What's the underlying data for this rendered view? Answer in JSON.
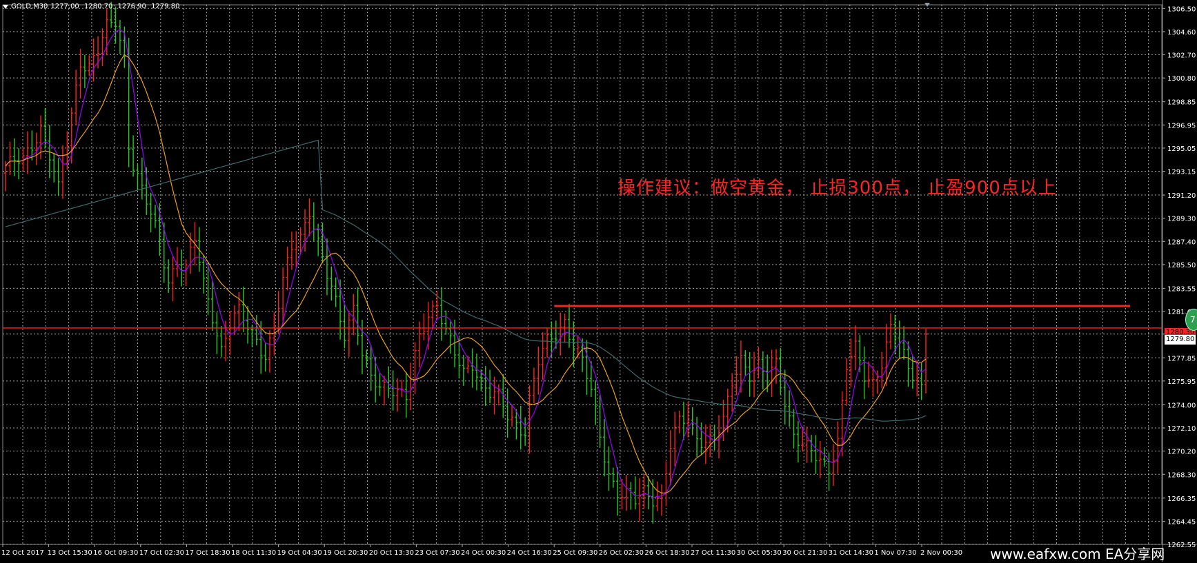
{
  "header": {
    "symbol": "GOLD,M30",
    "open": "1277.00",
    "high": "1280.70",
    "low": "1276.90",
    "close": "1279.80"
  },
  "annotation": "操作建议：做空黄金，  止损300点，  止盈900点以上",
  "watermark": "www.eafxw.com  EA分享网",
  "price_labels": {
    "current_price": "1279.80",
    "line_price": "1280.30",
    "badge": "7"
  },
  "colors": {
    "background": "#000000",
    "grid": "#cfcfcf",
    "bull_candle": "#ff2020",
    "bear_candle": "#22cc22",
    "ma_fast": "#9a00ff",
    "ma_mid": "#e8a020",
    "ma_slow": "#3d6b6b",
    "level_lines": "#ff2020"
  },
  "chart_data": {
    "type": "candlestick",
    "symbol": "GOLD",
    "timeframe": "M30",
    "ylim": [
      1262.55,
      1306.8
    ],
    "y_ticks": [
      "1306.50",
      "1304.60",
      "1302.70",
      "1300.80",
      "1298.85",
      "1296.95",
      "1295.05",
      "1293.15",
      "1291.20",
      "1289.30",
      "1287.40",
      "1285.50",
      "1283.55",
      "1281.65",
      "1279.80",
      "1277.85",
      "1275.95",
      "1274.00",
      "1272.10",
      "1270.20",
      "1268.30",
      "1266.35",
      "1264.45",
      "1262.55"
    ],
    "x_ticks": [
      "12 Oct 2017",
      "13 Oct 15:30",
      "16 Oct 09:30",
      "17 Oct 02:30",
      "17 Oct 18:30",
      "18 Oct 11:30",
      "19 Oct 04:30",
      "19 Oct 20:30",
      "20 Oct 13:30",
      "23 Oct 07:30",
      "24 Oct 00:30",
      "24 Oct 16:30",
      "25 Oct 09:30",
      "26 Oct 02:30",
      "26 Oct 18:30",
      "27 Oct 11:30",
      "30 Oct 05:30",
      "30 Oct 21:30",
      "31 Oct 14:30",
      "1 Nov 07:30",
      "2 Nov 00:30"
    ],
    "close_path": [
      [
        0,
        1293.6
      ],
      [
        4,
        1294.0
      ],
      [
        8,
        1296.8
      ],
      [
        10,
        1294.5
      ],
      [
        12,
        1291.5
      ],
      [
        14,
        1295.5
      ],
      [
        17,
        1302.3
      ],
      [
        19,
        1301.8
      ],
      [
        21,
        1303.0
      ],
      [
        23,
        1304.8
      ],
      [
        25,
        1305.5
      ],
      [
        27,
        1302.5
      ],
      [
        28,
        1295.5
      ],
      [
        29,
        1293.8
      ],
      [
        31,
        1291.5
      ],
      [
        33,
        1289.5
      ],
      [
        35,
        1287.5
      ],
      [
        37,
        1284.3
      ],
      [
        39,
        1285.8
      ],
      [
        41,
        1285.0
      ],
      [
        43,
        1287.5
      ],
      [
        45,
        1284.0
      ],
      [
        47,
        1281.5
      ],
      [
        49,
        1278.5
      ],
      [
        51,
        1280.5
      ],
      [
        53,
        1281.5
      ],
      [
        55,
        1280.5
      ],
      [
        57,
        1279.5
      ],
      [
        59,
        1278.0
      ],
      [
        61,
        1280.0
      ],
      [
        63,
        1284.0
      ],
      [
        65,
        1287.0
      ],
      [
        67,
        1288.0
      ],
      [
        69,
        1290.0
      ],
      [
        70,
        1288.5
      ],
      [
        71,
        1287.0
      ],
      [
        73,
        1284.5
      ],
      [
        75,
        1282.5
      ],
      [
        77,
        1280.0
      ],
      [
        79,
        1282.0
      ],
      [
        81,
        1278.0
      ],
      [
        83,
        1276.0
      ],
      [
        85,
        1275.5
      ],
      [
        87,
        1275.8
      ],
      [
        89,
        1275.2
      ],
      [
        91,
        1274.5
      ],
      [
        92,
        1276.0
      ],
      [
        94,
        1279.5
      ],
      [
        96,
        1281.5
      ],
      [
        98,
        1282.5
      ],
      [
        100,
        1280.0
      ],
      [
        102,
        1278.0
      ],
      [
        104,
        1276.5
      ],
      [
        106,
        1277.5
      ],
      [
        108,
        1276.0
      ],
      [
        110,
        1275.0
      ],
      [
        112,
        1274.5
      ],
      [
        114,
        1273.0
      ],
      [
        116,
        1272.5
      ],
      [
        118,
        1272.0
      ],
      [
        119,
        1274.5
      ],
      [
        121,
        1277.5
      ],
      [
        123,
        1279.0
      ],
      [
        125,
        1279.8
      ],
      [
        127,
        1281.0
      ],
      [
        129,
        1279.0
      ],
      [
        131,
        1277.5
      ],
      [
        133,
        1275.0
      ],
      [
        135,
        1271.5
      ],
      [
        137,
        1268.5
      ],
      [
        139,
        1266.8
      ],
      [
        141,
        1266.5
      ],
      [
        143,
        1266.0
      ],
      [
        145,
        1267.0
      ],
      [
        147,
        1266.5
      ],
      [
        149,
        1266.5
      ],
      [
        151,
        1270.5
      ],
      [
        153,
        1272.5
      ],
      [
        155,
        1273.0
      ],
      [
        157,
        1271.5
      ],
      [
        159,
        1271.0
      ],
      [
        161,
        1271.0
      ],
      [
        163,
        1272.5
      ],
      [
        165,
        1276.0
      ],
      [
        167,
        1278.0
      ],
      [
        169,
        1276.5
      ],
      [
        171,
        1277.0
      ],
      [
        173,
        1276.0
      ],
      [
        175,
        1277.5
      ],
      [
        177,
        1274.5
      ],
      [
        179,
        1271.5
      ],
      [
        181,
        1270.5
      ],
      [
        183,
        1270.0
      ],
      [
        185,
        1269.5
      ],
      [
        187,
        1269.0
      ],
      [
        189,
        1271.0
      ],
      [
        191,
        1277.0
      ],
      [
        193,
        1278.5
      ],
      [
        195,
        1276.5
      ],
      [
        197,
        1276.0
      ],
      [
        199,
        1277.5
      ],
      [
        201,
        1280.0
      ],
      [
        203,
        1279.0
      ],
      [
        205,
        1277.0
      ],
      [
        207,
        1276.5
      ],
      [
        208,
        1275.5
      ],
      [
        209,
        1279.8
      ]
    ],
    "bar_count": 210,
    "moving_averages": [
      {
        "role": "fast",
        "period": 5
      },
      {
        "role": "mid",
        "period": 13
      },
      {
        "role": "slow",
        "period": 72
      }
    ],
    "horizontal_lines": [
      {
        "price": 1282.1,
        "style": "thick",
        "from_bar": 129,
        "to_end": true
      },
      {
        "price": 1280.3,
        "style": "thin",
        "from_bar": 0,
        "to_end": true
      }
    ],
    "grid": true
  }
}
